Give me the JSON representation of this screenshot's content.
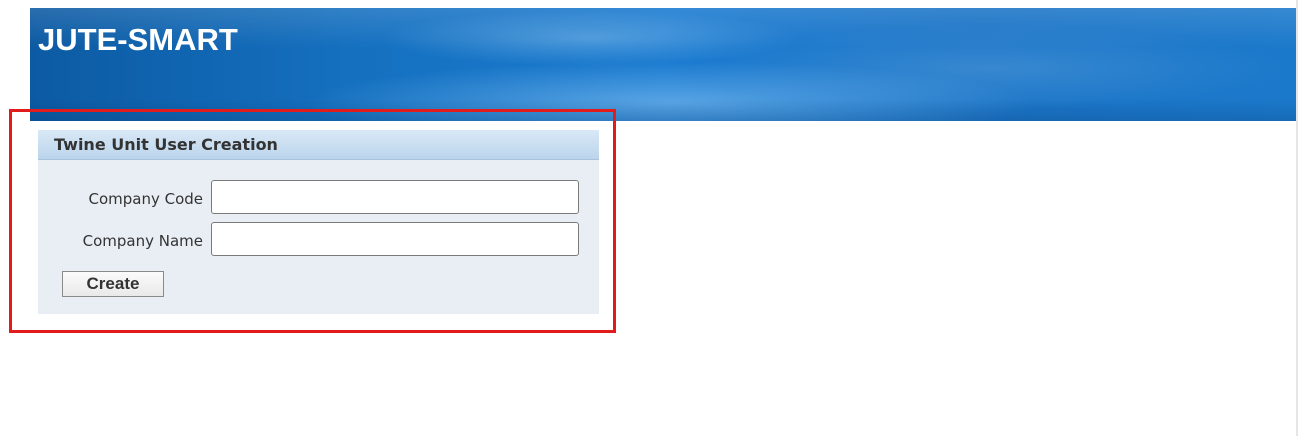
{
  "header": {
    "app_title": "JUTE-SMART"
  },
  "form": {
    "title": "Twine Unit User Creation",
    "fields": [
      {
        "label": "Company Code",
        "value": "",
        "placeholder": ""
      },
      {
        "label": "Company Name",
        "value": "",
        "placeholder": ""
      }
    ],
    "create_label": "Create"
  },
  "colors": {
    "banner_blue": "#1a7ad0",
    "panel_background": "#e8eef4",
    "panel_header": "#bcd5ec",
    "highlight_frame": "#e21b1b"
  }
}
